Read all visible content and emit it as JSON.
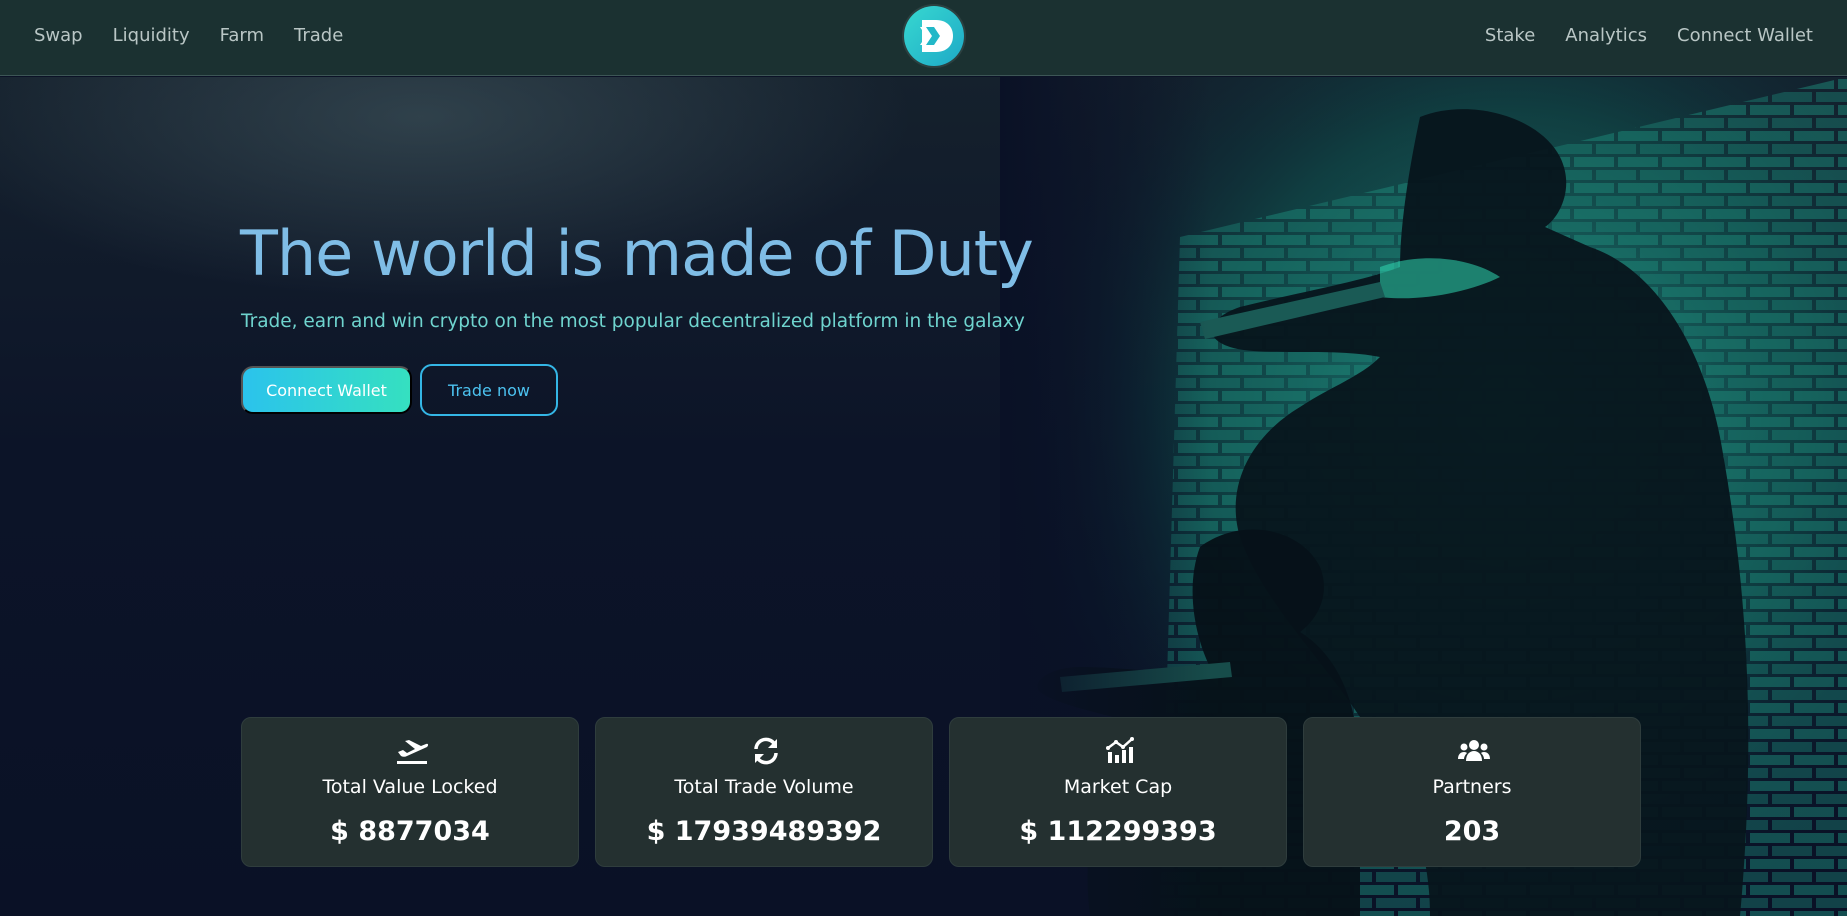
{
  "header": {
    "nav_left": [
      {
        "label": "Swap"
      },
      {
        "label": "Liquidity"
      },
      {
        "label": "Farm"
      },
      {
        "label": "Trade"
      }
    ],
    "nav_right": [
      {
        "label": "Stake"
      },
      {
        "label": "Analytics"
      },
      {
        "label": "Connect Wallet"
      }
    ],
    "logo_icon": "d-logo-icon"
  },
  "hero": {
    "title": "The world is made of Duty",
    "subtitle": "Trade, earn and win crypto on the most popular decentralized platform in the galaxy",
    "primary_button": "Connect Wallet",
    "secondary_button": "Trade now",
    "image": "soldiers-hero-image"
  },
  "stats": [
    {
      "icon": "plane-departure-icon",
      "label": "Total Value Locked",
      "value": "$ 8877034"
    },
    {
      "icon": "sync-icon",
      "label": "Total Trade Volume",
      "value": "$ 17939489392"
    },
    {
      "icon": "chart-icon",
      "label": "Market Cap",
      "value": "$ 112299393"
    },
    {
      "icon": "users-icon",
      "label": "Partners",
      "value": "203"
    }
  ],
  "colors": {
    "header_bg": "#1b3131",
    "title": "#7fbde6",
    "subtitle": "#6fd4cf",
    "accent_from": "#2bc3ec",
    "accent_to": "#35e0c0",
    "card_bg": "#243030"
  }
}
